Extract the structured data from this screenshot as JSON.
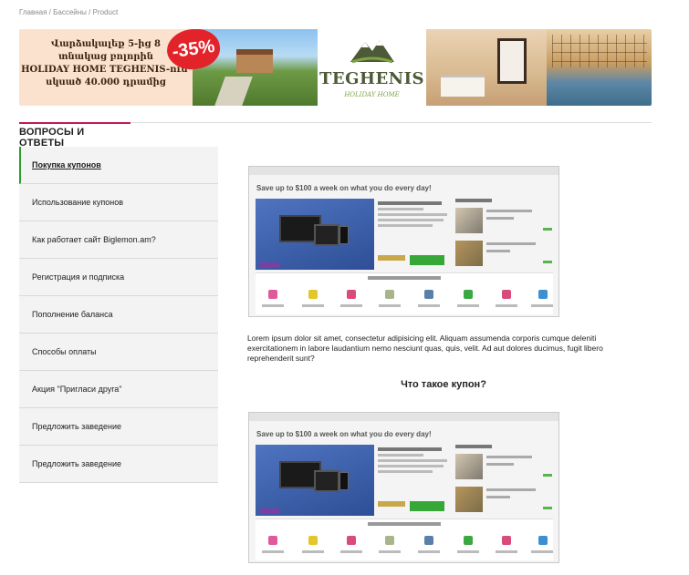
{
  "breadcrumb": {
    "items": [
      "Главная",
      "Бассейны",
      "Product"
    ],
    "separator": " / "
  },
  "banner": {
    "promo_lines": [
      "Վարձակալեք 5-ից 8",
      "տնակաց բոլորին",
      "HOLIDAY HOME TEGHENIS-ում՝",
      "սկսած 40.000 դրամից"
    ],
    "discount": "-35%",
    "logo_name": "TEGHENIS",
    "logo_sub": "HOLIDAY HOME",
    "discount_color": "#e3232a",
    "logo_color": "#4d5a37"
  },
  "faq": {
    "title": "ВОПРОСЫ И ОТВЕТЫ",
    "accent_color": "#c2185b",
    "active_color": "#2e9c2e",
    "items": [
      "Покупка купонов",
      "Использование купонов",
      "Как работает сайт Biglemon.am?",
      "Регистрация и подписка",
      "Пополнение баланса",
      "Способы оплаты",
      "Акция \"Пригласи друга\"",
      "Предложить заведение",
      "Предложить заведение"
    ],
    "active_index": 0
  },
  "article": {
    "screenshot_headline": "Save up to $100 a week on what you do every day!",
    "body": "Lorem ipsum dolor sit amet, consectetur adipisicing elit. Aliquam assumenda corporis cumque deleniti exercitationem in labore laudantium nemo nesciunt quas, quis, velit. Ad aut dolores ducimus, fugit libero reprehenderit sunt?",
    "heading": "Что такое купон?"
  }
}
